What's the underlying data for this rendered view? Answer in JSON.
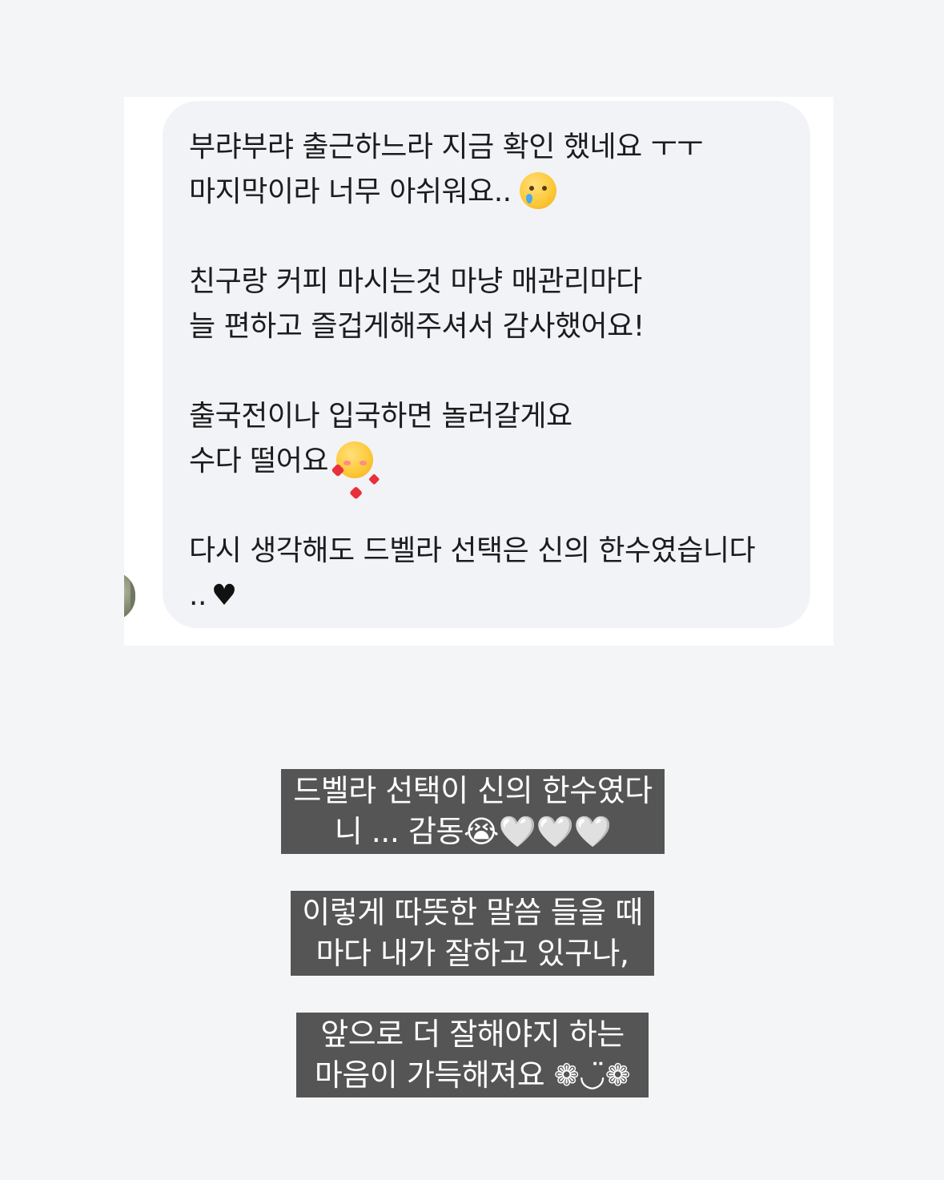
{
  "message": {
    "paragraphs": [
      {
        "lines": [
          "부랴부랴 출근하느라 지금 확인 했네요 ㅜㅜ",
          "마지막이라 너무 아쉬워요.."
        ]
      },
      {
        "lines": [
          "친구랑 커피 마시는것 마냥 매관리마다",
          "늘 편하고 즐겁게해주셔서 감사했어요!"
        ]
      },
      {
        "lines": [
          "출국전이나 입국하면 놀러갈게요",
          "수다 떨어요"
        ]
      },
      {
        "lines": [
          "다시 생각해도 드벨라 선택은 신의 한수였습니다",
          ".."
        ]
      }
    ],
    "emoji_cry_name": "crying-face-emoji",
    "emoji_love_name": "smiling-face-with-hearts-emoji",
    "heart_glyph": "♥"
  },
  "captions": [
    {
      "lines": [
        "드벨라 선택이 신의 한수였다",
        "니 ... 감동😭🤍🤍🤍"
      ]
    },
    {
      "lines": [
        "이렇게 따뜻한 말씀 들을 때",
        "마다 내가 잘하고 있구나,"
      ]
    },
    {
      "lines": [
        "앞으로 더 잘해야지 하는",
        "마음이 가득해져요 ❁◡̈❁"
      ]
    }
  ],
  "colors": {
    "background": "#f4f5f7",
    "card": "#ffffff",
    "bubble": "#f2f3f6",
    "text": "#1c1c1e",
    "caption_bg": "#555555",
    "caption_text": "#ffffff"
  }
}
